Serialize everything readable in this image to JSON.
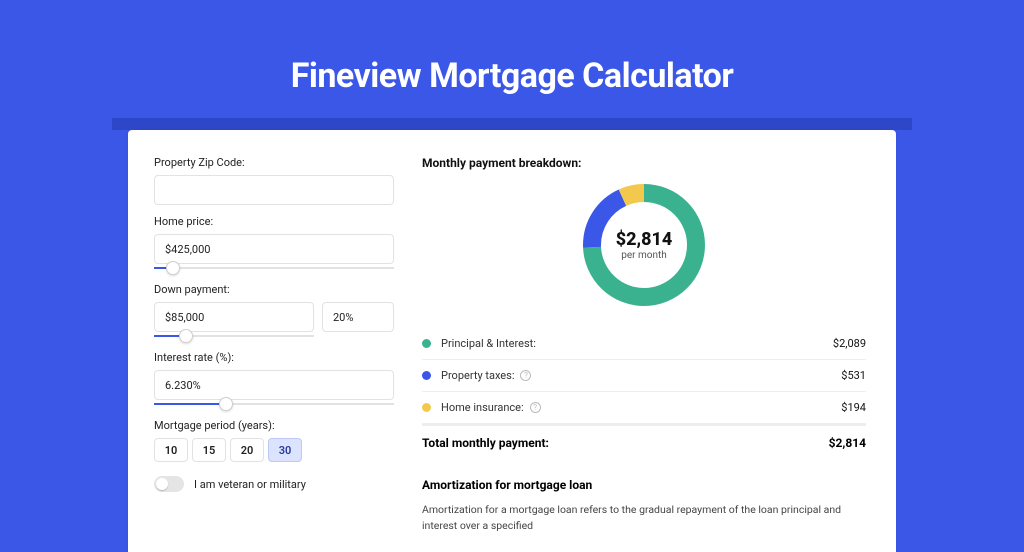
{
  "page": {
    "title": "Fineview Mortgage Calculator"
  },
  "form": {
    "zip_label": "Property Zip Code:",
    "zip_value": "",
    "home_price_label": "Home price:",
    "home_price_value": "$425,000",
    "home_price_slider_pct": 8,
    "down_payment_label": "Down payment:",
    "down_payment_value": "$85,000",
    "down_payment_pct_value": "20%",
    "down_payment_slider_pct": 20,
    "interest_label": "Interest rate (%):",
    "interest_value": "6.230%",
    "interest_slider_pct": 30,
    "period_label": "Mortgage period (years):",
    "periods": [
      "10",
      "15",
      "20",
      "30"
    ],
    "period_selected": "30",
    "toggle_label": "I am veteran or military",
    "toggle_on": false
  },
  "breakdown": {
    "title": "Monthly payment breakdown:",
    "center_value": "$2,814",
    "center_sub": "per month",
    "items": [
      {
        "name": "Principal & Interest:",
        "amount": "$2,089",
        "color": "#3bb28f",
        "has_info": false
      },
      {
        "name": "Property taxes:",
        "amount": "$531",
        "color": "#3a57e8",
        "has_info": true
      },
      {
        "name": "Home insurance:",
        "amount": "$194",
        "color": "#f2c94c",
        "has_info": true
      }
    ],
    "total_label": "Total monthly payment:",
    "total_amount": "$2,814"
  },
  "chart_data": {
    "type": "pie",
    "title": "Monthly payment breakdown",
    "series": [
      {
        "name": "Principal & Interest",
        "value": 2089,
        "color": "#3bb28f"
      },
      {
        "name": "Property taxes",
        "value": 531,
        "color": "#3a57e8"
      },
      {
        "name": "Home insurance",
        "value": 194,
        "color": "#f2c94c"
      }
    ],
    "total": 2814,
    "center_label": "$2,814 per month"
  },
  "amortization": {
    "title": "Amortization for mortgage loan",
    "text": "Amortization for a mortgage loan refers to the gradual repayment of the loan principal and interest over a specified"
  }
}
